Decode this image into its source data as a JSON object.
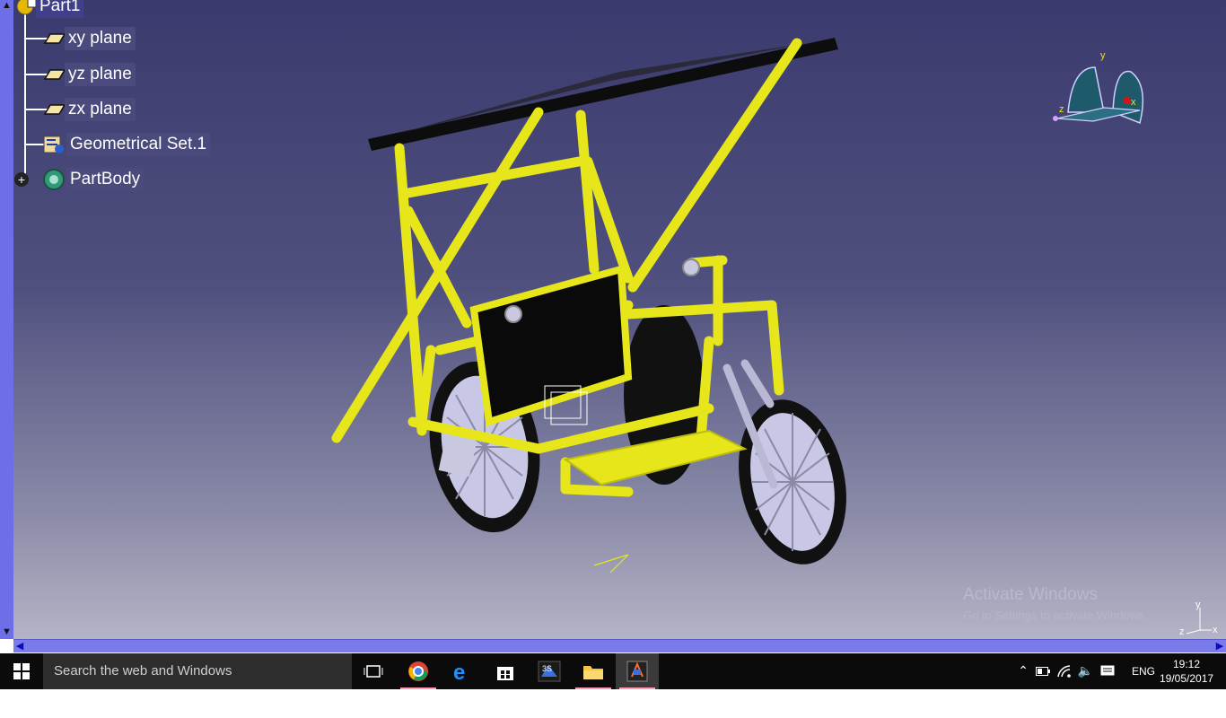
{
  "tree": {
    "root_label": "Part1",
    "items": [
      {
        "label": "xy plane",
        "icon": "plane-icon"
      },
      {
        "label": "yz plane",
        "icon": "plane-icon"
      },
      {
        "label": "zx plane",
        "icon": "plane-icon"
      },
      {
        "label": "Geometrical Set.1",
        "icon": "geometrical-set-icon"
      },
      {
        "label": "PartBody",
        "icon": "part-body-icon"
      }
    ]
  },
  "compass": {
    "x_label": "x",
    "y_label": "y",
    "z_label": "z"
  },
  "axis_triad": {
    "x_label": "x",
    "y_label": "y",
    "z_label": "z"
  },
  "watermark": {
    "title": "Activate Windows",
    "subtitle": "Go to Settings to activate Windows."
  },
  "taskbar": {
    "search_placeholder": "Search the web and Windows",
    "language": "ENG",
    "time": "19:12",
    "date": "19/05/2017"
  },
  "colors": {
    "frame": "#e6e61a",
    "viewport_top": "#3a3a6e",
    "scrollbar": "#6e6ee8",
    "taskbar": "#0b0b0b"
  }
}
